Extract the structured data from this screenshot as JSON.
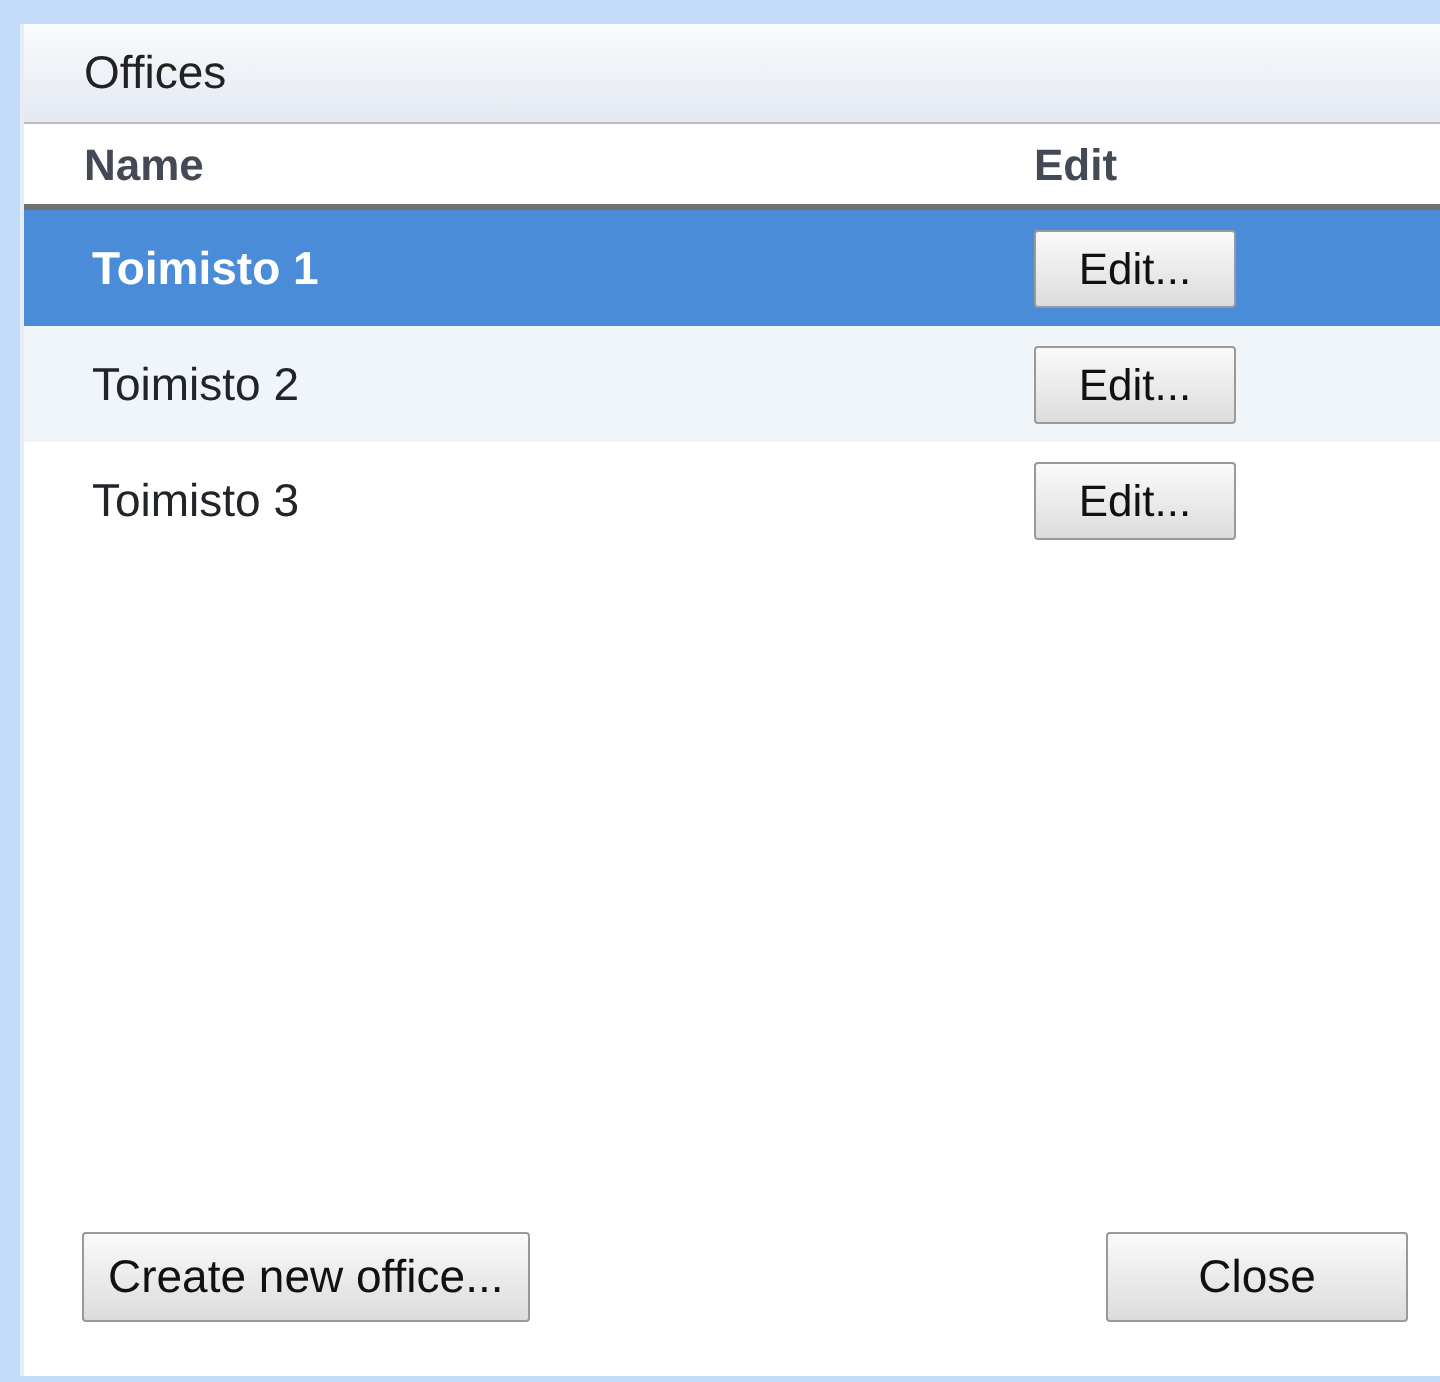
{
  "panel": {
    "title": "Offices"
  },
  "columns": [
    "Name",
    "Edit"
  ],
  "rows": [
    {
      "name": "Toimisto 1",
      "button": "Edit...",
      "selected": true
    },
    {
      "name": "Toimisto 2",
      "button": "Edit...",
      "selected": false
    },
    {
      "name": "Toimisto 3",
      "button": "Edit...",
      "selected": false
    }
  ],
  "buttons": [
    "Create new office...",
    "Close"
  ]
}
